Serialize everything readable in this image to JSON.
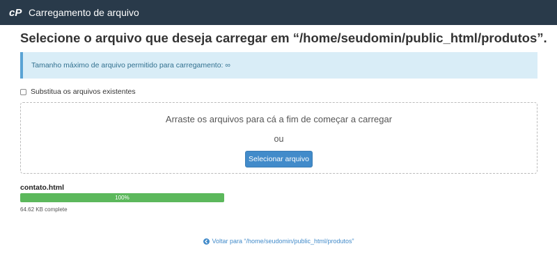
{
  "header": {
    "title": "Carregamento de arquivo",
    "logo_icon": "cpanel-logo-icon"
  },
  "page": {
    "title": "Selecione o arquivo que deseja carregar em “/home/seudomin/public_html/produtos”."
  },
  "alert": {
    "text": "Tamanho máximo de arquivo permitido para carregamento: ∞"
  },
  "options": {
    "overwrite_label": "Substitua os arquivos existentes",
    "overwrite_checked": false
  },
  "dropzone": {
    "instruction": "Arraste os arquivos para cá a fim de começar a carregar",
    "or_text": "ou",
    "select_button_label": "Selecionar arquivo"
  },
  "upload": {
    "file_name": "contato.html",
    "progress_percent": 100,
    "progress_label": "100%",
    "status_text": "64.62 KB complete"
  },
  "footer": {
    "back_link_text": "Voltar para “/home/seudomin/public_html/produtos”",
    "back_icon": "arrow-circle-left-icon"
  },
  "colors": {
    "header_bg": "#293a4a",
    "alert_bg": "#d9edf7",
    "button_bg": "#428bca",
    "progress_fill": "#5cb85c"
  }
}
